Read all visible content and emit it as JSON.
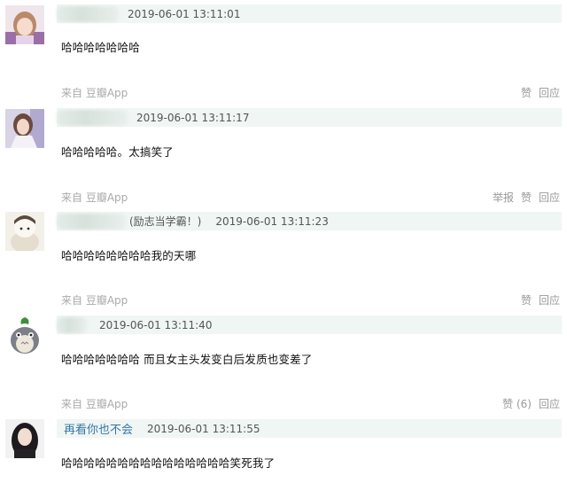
{
  "comments": [
    {
      "avatar_icon": "avatar-girl-icon",
      "username": "",
      "tag": "",
      "time": "2019-06-01 13:11:01",
      "text": "哈哈哈哈哈哈哈",
      "source": "来自 豆瓣App",
      "actions": [
        "赞",
        "回应"
      ]
    },
    {
      "avatar_icon": "avatar-girl-photo-icon",
      "username": "",
      "tag": "",
      "time": "2019-06-01 13:11:17",
      "text": "哈哈哈哈哈。太搞笑了",
      "source": "来自 豆瓣App",
      "actions": [
        "举报",
        "赞",
        "回应"
      ]
    },
    {
      "avatar_icon": "avatar-cartoon-icon",
      "username": "",
      "tag": "(励志当学霸！)",
      "time": "2019-06-01 13:11:23",
      "text": "哈哈哈哈哈哈哈哈我的天哪",
      "source": "来自 豆瓣App",
      "actions": [
        "赞",
        "回应"
      ]
    },
    {
      "avatar_icon": "totoro-icon",
      "username": "",
      "tag": "",
      "time": "2019-06-01 13:11:40",
      "text": "哈哈哈哈哈哈哈 而且女主头发变白后发质也变差了",
      "source": "来自 豆瓣App",
      "actions": [
        "赞 (6)",
        "回应"
      ]
    },
    {
      "avatar_icon": "avatar-dark-hair-icon",
      "username": "再看你也不会",
      "tag": "",
      "time": "2019-06-01 13:11:55",
      "text": "哈哈哈哈哈哈哈哈哈哈哈哈哈哈哈笑死我了",
      "source": "",
      "actions": []
    }
  ]
}
